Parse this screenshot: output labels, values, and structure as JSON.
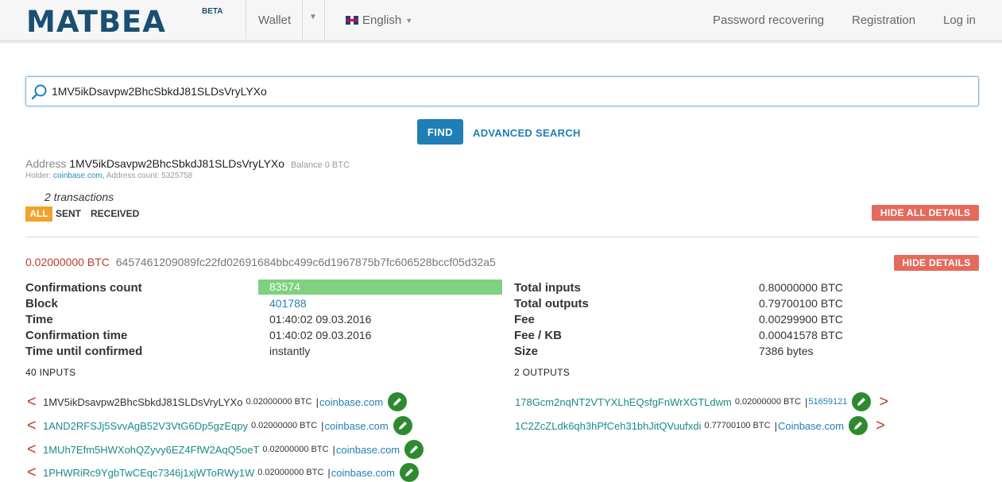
{
  "header": {
    "logo": "MATBEA",
    "logo_badge": "BETA",
    "nav_wallet": "Wallet",
    "nav_language": "English",
    "nav_password": "Password recovering",
    "nav_registration": "Registration",
    "nav_login": "Log in"
  },
  "search": {
    "value": "1MV5ikDsavpw2BhcSbkdJ81SLDsVryLYXo",
    "find_label": "FIND",
    "advanced_label": "ADVANCED SEARCH"
  },
  "address": {
    "label": "Address",
    "value": "1MV5ikDsavpw2BhcSbkdJ81SLDsVryLYXo",
    "balance": "Balance 0 BTC",
    "holder_label": "Holder:",
    "holder": "coinbase.com,",
    "address_count": "Address count: 5325758",
    "tx_count": "2 transactions"
  },
  "filters": {
    "all": "ALL",
    "sent": "SENT",
    "received": "RECEIVED",
    "hide_all": "HIDE ALL DETAILS"
  },
  "transaction": {
    "amount": "0.02000000 BTC",
    "hash": "6457461209089fc22fd02691684bbc499c6d1967875b7fc606528bccf05d32a5",
    "hide_details": "HIDE DETAILS",
    "labels": {
      "confirmations": "Confirmations count",
      "block": "Block",
      "time": "Time",
      "confirmation_time": "Confirmation time",
      "time_until": "Time until confirmed",
      "total_inputs": "Total inputs",
      "total_outputs": "Total outputs",
      "fee": "Fee",
      "fee_kb": "Fee / KB",
      "size": "Size"
    },
    "values": {
      "confirmations": "83574",
      "block": "401788",
      "time": "01:40:02 09.03.2016",
      "confirmation_time": "01:40:02 09.03.2016",
      "time_until": "instantly",
      "total_inputs": "0.80000000 BTC",
      "total_outputs": "0.79700100 BTC",
      "fee": "0.00299900 BTC",
      "fee_kb": "0.00041578 BTC",
      "size": "7386 bytes"
    },
    "inputs_heading": "40 INPUTS",
    "outputs_heading": "2 OUTPUTS",
    "inputs": [
      {
        "address": "1MV5ikDsavpw2BhcSbkdJ81SLDsVryLYXo",
        "amount": "0.02000000 BTC",
        "holder": "coinbase.com"
      },
      {
        "address": "1AND2RFSJj5SvvAgB52V3VtG6Dp5gzEqpy",
        "amount": "0.02000000 BTC",
        "holder": "coinbase.com"
      },
      {
        "address": "1MUh7Efm5HWXohQZyvy6EZ4FfW2AqQ5oeT",
        "amount": "0.02000000 BTC",
        "holder": "coinbase.com"
      },
      {
        "address": "1PHWRiRc9YgbTwCEqc7346j1xjWToRWy1W",
        "amount": "0.02000000 BTC",
        "holder": "coinbase.com"
      }
    ],
    "outputs": [
      {
        "address": "178Gcm2nqNT2VTYXLhEQsfgFnWrXGTLdwm",
        "amount": "0.02000000 BTC",
        "holder": "51659121"
      },
      {
        "address": "1C2ZcZLdk6qh3hPfCeh31bhJitQVuufxdi",
        "amount": "0.77700100 BTC",
        "holder": "Coinbase.com"
      }
    ],
    "separator": "|",
    "arrow_left": "<",
    "arrow_right": ">"
  },
  "colors": {
    "brand": "#1a4f71",
    "link": "#1f7fb6",
    "accent_orange": "#f0a32b",
    "danger": "#e36a5d",
    "confirm_green": "#7ed17e",
    "edit_green": "#2f8a2f"
  }
}
